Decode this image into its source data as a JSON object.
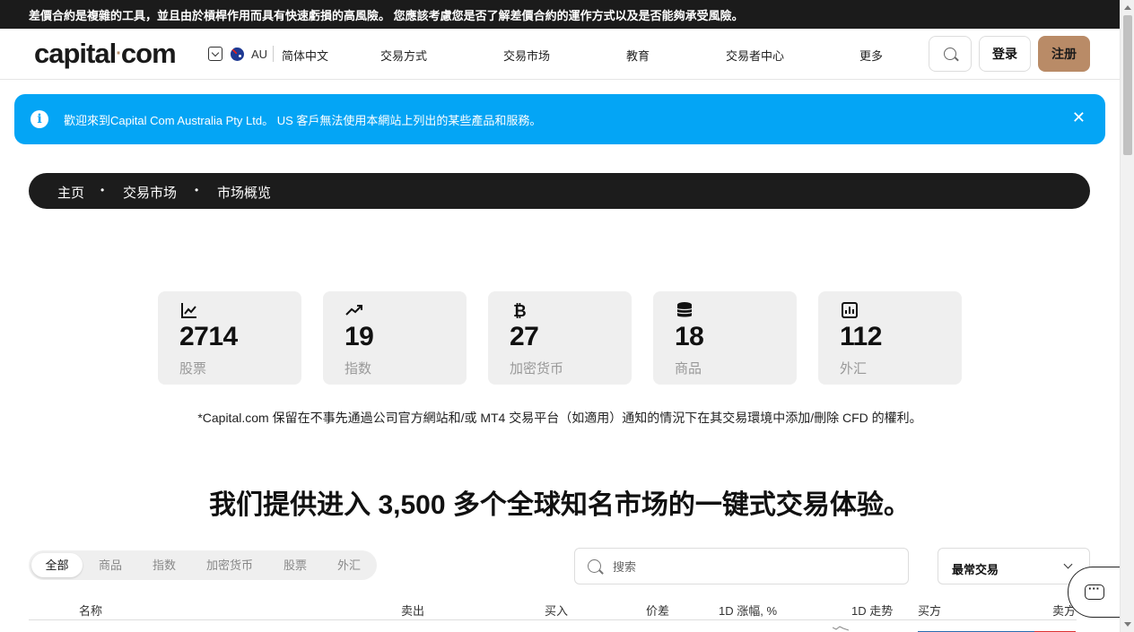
{
  "risk_warning": "差價合約是複雜的工具，並且由於槓桿作用而具有快速虧損的高風險。 您應該考慮您是否了解差價合約的運作方式以及是否能夠承受風險。",
  "header": {
    "logo_text": "capital",
    "logo_dot": "·",
    "logo_suffix": "com",
    "region_code": "AU",
    "language": "简体中文",
    "nav": [
      "交易方式",
      "交易市场",
      "教育",
      "交易者中心",
      "更多"
    ],
    "login_label": "登录",
    "signup_label": "注册"
  },
  "info_banner": {
    "text": "歡迎來到Capital Com Australia Pty Ltd。 US 客戶無法使用本網站上列出的某些產品和服務。",
    "close": "✕"
  },
  "breadcrumb": [
    "主页",
    "交易市场",
    "市场概览"
  ],
  "breadcrumb_sep": "•",
  "stats": [
    {
      "icon": "line-chart-icon",
      "value": "2714",
      "label": "股票"
    },
    {
      "icon": "trending-up-icon",
      "value": "19",
      "label": "指数"
    },
    {
      "icon": "bitcoin-icon",
      "value": "27",
      "label": "加密货币"
    },
    {
      "icon": "coins-stack-icon",
      "value": "18",
      "label": "商品"
    },
    {
      "icon": "bar-chart-icon",
      "value": "112",
      "label": "外汇"
    }
  ],
  "disclaimer": "*Capital.com 保留在不事先通過公司官方網站和/或 MT4 交易平台（如適用）通知的情況下在其交易環境中添加/刪除 CFD 的權利。",
  "headline": "我们提供进入 3,500 多个全球知名市场的一键式交易体验。",
  "market_tabs": [
    "全部",
    "商品",
    "指数",
    "加密货币",
    "股票",
    "外汇"
  ],
  "active_tab": "全部",
  "search": {
    "placeholder": "搜索"
  },
  "sort": {
    "selected": "最常交易"
  },
  "table_headers": [
    "名称",
    "卖出",
    "买入",
    "价差",
    "1D 涨幅, %",
    "1D 走势",
    "买方",
    "卖方"
  ],
  "colors": {
    "accent_blue": "#04a5f5",
    "brand_gold": "#b98b67",
    "dark": "#1c1c1c"
  }
}
